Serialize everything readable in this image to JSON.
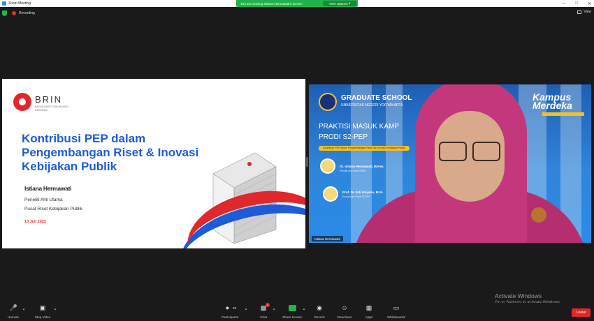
{
  "window": {
    "title": "Zoom Meeting"
  },
  "share_banner": {
    "text": "You are viewing Istiana Hermawati's screen",
    "options_label": "View Options"
  },
  "recording": {
    "label": "Recording"
  },
  "view": {
    "label": "View"
  },
  "slide": {
    "brand": "BRIN",
    "brand_sub": "BADAN RISET DAN INOVASI NASIONAL",
    "title_lines": [
      "Kontribusi PEP dalam",
      "Pengembangan Riset & Inovasi",
      "Kebijakan Publik"
    ],
    "author_name": "Istiana Hermawati",
    "author_role": "Peneliti Ahli Utama",
    "author_inst": "Pusat Riset Kebijakan Publik",
    "date": "13 Juli 2022"
  },
  "video": {
    "school": "GRADUATE SCHOOL",
    "university": "UNIVERSITAS NEGERI YOGYAKARTA",
    "event_line1": "PRAKTISI MASUK KAMP",
    "event_line2": "PRODI S2-PEP",
    "topic": "Kontribusi PEP dalam Pengembangan Riset dan Inovasi Kebijakan Publik",
    "speakers": [
      {
        "name": "Dr. Istiana Hermawati, M.Kes.",
        "role": "Peneliti Ahli Utama BRIN"
      },
      {
        "name": "Prof. Dr. Edi Istiyono, M.Si.",
        "role": "Koordinator Prodi S2 PEP"
      }
    ],
    "kampus": "Kampus Merdeka",
    "kampus_sub": "INDONESIA JAYA",
    "participant_name": "Istiana Hermawati"
  },
  "activate_windows": {
    "line1": "Activate Windows",
    "line2": "Go to Settings to activate Windows."
  },
  "toolbar": {
    "unmute": "Unmute",
    "stop_video": "Stop Video",
    "participants": "Participants",
    "participants_count": "58",
    "chat": "Chat",
    "chat_badge": "1",
    "share_screen": "Share Screen",
    "record": "Record",
    "reactions": "Reactions",
    "apps": "Apps",
    "whiteboards": "Whiteboards",
    "leave": "Leave"
  },
  "colors": {
    "zoom_green": "#22b24c",
    "brin_red": "#e0272c",
    "brin_blue": "#1e5bd8",
    "leave_red": "#e02828"
  }
}
